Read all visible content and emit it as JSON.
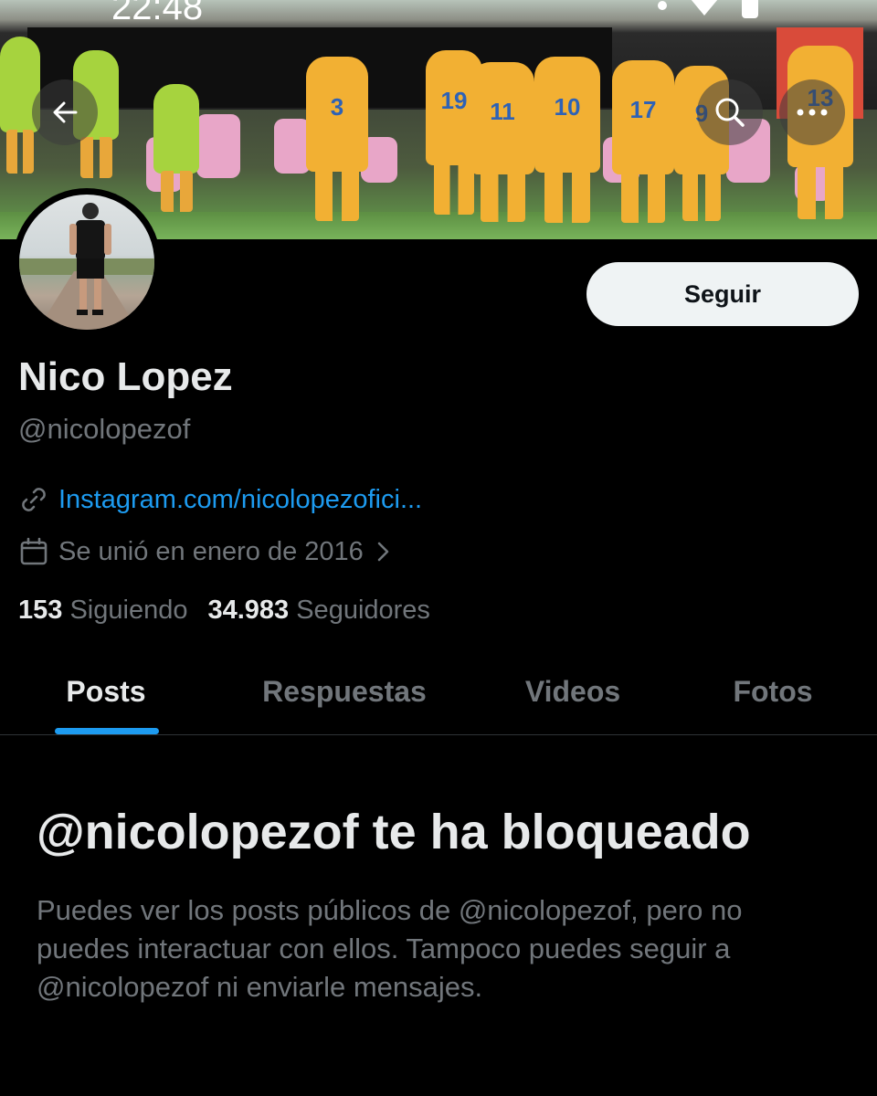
{
  "status_bar": {
    "time": "22:48"
  },
  "banner": {
    "jersey_numbers": [
      "3",
      "19",
      "11",
      "10",
      "17",
      "9",
      "13"
    ]
  },
  "header": {
    "back_icon": "arrow-left-icon",
    "search_icon": "search-icon",
    "more_icon": "more-horizontal-icon"
  },
  "profile": {
    "name": "Nico Lopez",
    "handle": "@nicolopezof",
    "follow_label": "Seguir",
    "link": "Instagram.com/nicolopezofici...",
    "joined": "Se unió en enero de 2016",
    "following_count": "153",
    "following_label": "Siguiendo",
    "followers_count": "34.983",
    "followers_label": "Seguidores"
  },
  "tabs": [
    {
      "label": "Posts",
      "active": true
    },
    {
      "label": "Respuestas",
      "active": false
    },
    {
      "label": "Videos",
      "active": false
    },
    {
      "label": "Fotos",
      "active": false
    }
  ],
  "blocked": {
    "title": "@nicolopezof te ha bloqueado",
    "message": "Puedes ver los posts públicos de @nicolopezof, pero no puedes interactuar con ellos. Tampoco puedes seguir a @nicolopezof ni enviarle mensajes."
  },
  "colors": {
    "background": "#000000",
    "accent": "#1d9bf0",
    "secondary_text": "#71767b",
    "primary_text": "#e7e9ea"
  }
}
